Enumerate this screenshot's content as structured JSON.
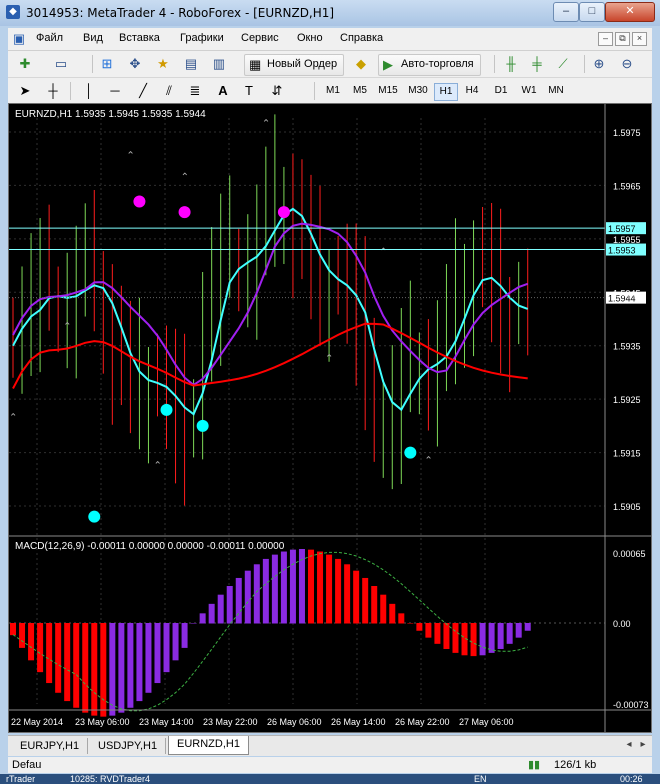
{
  "window": {
    "title": "3014953: MetaTrader 4 - RoboForex - [EURNZD,H1]",
    "minimize_glyph": "–",
    "maximize_glyph": "□",
    "close_glyph": "✕"
  },
  "menu": {
    "items": [
      "Файл",
      "Вид",
      "Вставка",
      "Графики",
      "Сервис",
      "Окно",
      "Справка"
    ],
    "mdi_min": "–",
    "mdi_restore": "⧉",
    "mdi_close": "×"
  },
  "toolbar1": {
    "new_order_label": "Новый Ордер",
    "autotrading_label": "Авто-торговля"
  },
  "toolbar2": {
    "text_tool": "A",
    "timeframes": [
      "M1",
      "M5",
      "M15",
      "M30",
      "H1",
      "H4",
      "D1",
      "W1",
      "MN"
    ],
    "active_timeframe": "H1"
  },
  "chart": {
    "header": "EURNZD,H1  1.5935 1.5945 1.5935 1.5944",
    "price_labels": [
      "1.5975",
      "1.5965",
      "1.5955",
      "1.5945",
      "1.5935",
      "1.5925",
      "1.5915",
      "1.5905"
    ],
    "hline_labels": [
      "1.5957",
      "1.5953"
    ],
    "bid_label": "1.5944",
    "bid_value": 1.5944,
    "hlines": [
      1.5957,
      1.5953
    ],
    "macd_header": "MACD(12,26,9) -0.00011 0.00000 0.00000 -0.00011 0.00000",
    "macd_labels": [
      "0.00065",
      "0.00",
      "-0.00073"
    ],
    "time_labels": [
      "22 May 2014",
      "23 May 06:00",
      "23 May 14:00",
      "23 May 22:00",
      "26 May 06:00",
      "26 May 14:00",
      "26 May 22:00",
      "27 May 06:00"
    ],
    "colors": {
      "bull": "#7ed957",
      "bear": "#ff1d1d",
      "ma_cyan": "#40ffff",
      "ma_purple": "#a020f0",
      "ma_red": "#ff0000",
      "macd_pos": "#ff0000",
      "macd_neg": "#8a2be2",
      "signal": "#3cb043",
      "grid": "#2f2f2f"
    }
  },
  "tabs": [
    "EURJPY,H1",
    "USDJPY,H1",
    "EURNZD,H1"
  ],
  "active_tab": "EURNZD,H1",
  "status": {
    "profile": "Defau",
    "traffic": "126/1 kb"
  },
  "taskbar": {
    "items": [
      "rTrader",
      "10285: RVDTrader4"
    ],
    "lang": "EN",
    "time": "00:26"
  }
}
